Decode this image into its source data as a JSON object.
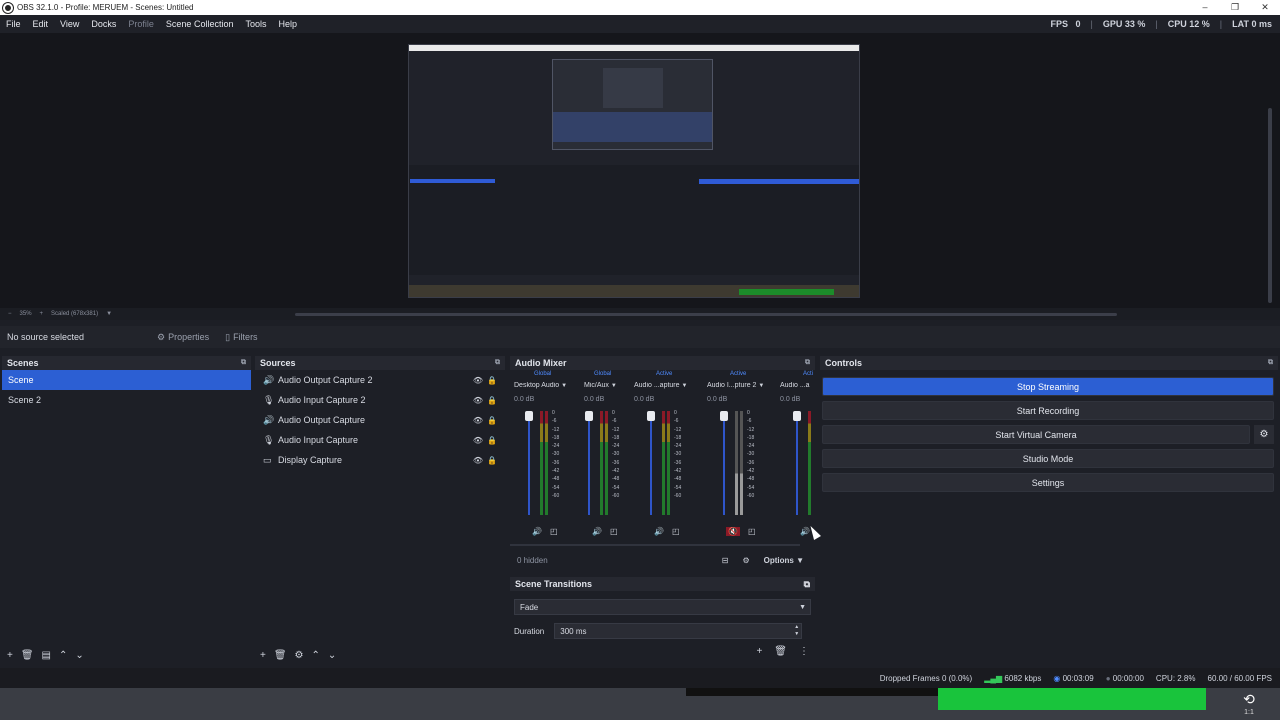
{
  "window": {
    "title": "OBS 32.1.0 - Profile: MERUEM - Scenes: Untitled",
    "controls": [
      "–",
      "❐",
      "✕"
    ]
  },
  "menu": [
    "File",
    "Edit",
    "View",
    "Docks",
    "Profile",
    "Scene Collection",
    "Tools",
    "Help"
  ],
  "stats": {
    "fps_label": "FPS",
    "fps_value": "0",
    "gpu_label": "GPU",
    "gpu_value": "33 %",
    "cpu_label": "CPU",
    "cpu_value": "12 %",
    "lat_label": "LAT",
    "lat_value": "0 ms"
  },
  "preview": {
    "zoom": "35%",
    "scaled_label": "Scaled (678x381)"
  },
  "source_bar": {
    "no_source": "No source selected",
    "properties": "Properties",
    "filters": "Filters"
  },
  "scenes": {
    "header": "Scenes",
    "items": [
      {
        "label": "Scene",
        "selected": true
      },
      {
        "label": "Scene 2",
        "selected": false
      }
    ]
  },
  "sources": {
    "header": "Sources",
    "items": [
      {
        "label": "Audio Output Capture 2",
        "icon": "speaker-icon"
      },
      {
        "label": "Audio Input Capture 2",
        "icon": "microphone-icon"
      },
      {
        "label": "Audio Output Capture",
        "icon": "speaker-icon"
      },
      {
        "label": "Audio Input Capture",
        "icon": "microphone-icon"
      },
      {
        "label": "Display Capture",
        "icon": "monitor-icon"
      }
    ]
  },
  "mixer": {
    "header": "Audio Mixer",
    "channels": [
      {
        "name": "Desktop Audio",
        "tag": "Global",
        "db": "0.0 dB",
        "muted": false
      },
      {
        "name": "Mic/Aux",
        "tag": "Global",
        "db": "0.0 dB",
        "muted": false
      },
      {
        "name": "Audio ...apture",
        "tag": "Active",
        "db": "0.0 dB",
        "muted": false
      },
      {
        "name": "Audio I...pture 2",
        "tag": "Active",
        "db": "0.0 dB",
        "muted": true
      },
      {
        "name": "Audio ...a",
        "tag": "Acti",
        "db": "0.0 dB",
        "muted": false
      }
    ],
    "scale": [
      "0",
      "-6",
      "-12",
      "-18",
      "-24",
      "-30",
      "-36",
      "-42",
      "-48",
      "-54",
      "-60"
    ],
    "hidden": "0 hidden",
    "options": "Options"
  },
  "transitions": {
    "header": "Scene Transitions",
    "selected": "Fade",
    "duration_label": "Duration",
    "duration_value": "300 ms"
  },
  "controls": {
    "header": "Controls",
    "buttons": [
      {
        "label": "Stop Streaming",
        "active": true
      },
      {
        "label": "Start Recording",
        "active": false
      },
      {
        "label": "Start Virtual Camera",
        "active": false
      },
      {
        "label": "Studio Mode",
        "active": false
      },
      {
        "label": "Settings",
        "active": false
      }
    ]
  },
  "status": {
    "dropped": "Dropped Frames 0 (0.0%)",
    "bitrate": "6082 kbps",
    "stream_time": "00:03:09",
    "rec_time": "00:00:00",
    "cpu": "CPU: 2.8%",
    "fps": "60.00 / 60.00 FPS"
  },
  "taskbar": {
    "clock_sub": "1:1"
  },
  "colors": {
    "accent": "#2c5fd3",
    "background": "#1d1f26",
    "meter_green": "#227a2c",
    "meter_yellow": "#8a7a1a",
    "meter_red": "#8b1a27"
  }
}
